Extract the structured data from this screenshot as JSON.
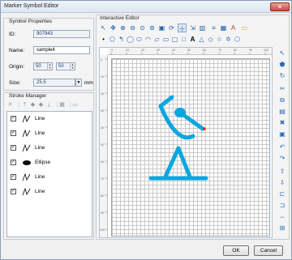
{
  "window": {
    "title": "Marker Symbol Editor",
    "close_label": "✕"
  },
  "properties": {
    "group_label": "Symbol Properties",
    "id_label": "ID:",
    "id_value": "907943",
    "name_label": "Name:",
    "name_value": "sample4",
    "origin_label": "Origin:",
    "origin_x": "50",
    "origin_y": "50",
    "size_label": "Size:",
    "size_value": "25.5",
    "size_unit": "mm"
  },
  "stroke_manager": {
    "group_label": "Stroke Manager",
    "items": [
      {
        "label": "Line",
        "checked": true,
        "kind": "line"
      },
      {
        "label": "Line",
        "checked": true,
        "kind": "line"
      },
      {
        "label": "Line",
        "checked": true,
        "kind": "line"
      },
      {
        "label": "Ellipse",
        "checked": true,
        "kind": "ellipse"
      },
      {
        "label": "Line",
        "checked": true,
        "kind": "line"
      },
      {
        "label": "Line",
        "checked": true,
        "kind": "line"
      }
    ]
  },
  "editor": {
    "group_label": "Interactive Editor",
    "stroke_color": "#0aa6df",
    "ruler_top_ticks": [
      "0",
      "10",
      "20",
      "30",
      "40",
      "50",
      "60",
      "70",
      "80",
      "90",
      "100"
    ],
    "ruler_left_ticks": [
      "0",
      "10",
      "20",
      "30",
      "40",
      "50",
      "60",
      "70",
      "80",
      "90",
      "100"
    ]
  },
  "footer": {
    "ok_label": "OK",
    "cancel_label": "Cancel"
  }
}
